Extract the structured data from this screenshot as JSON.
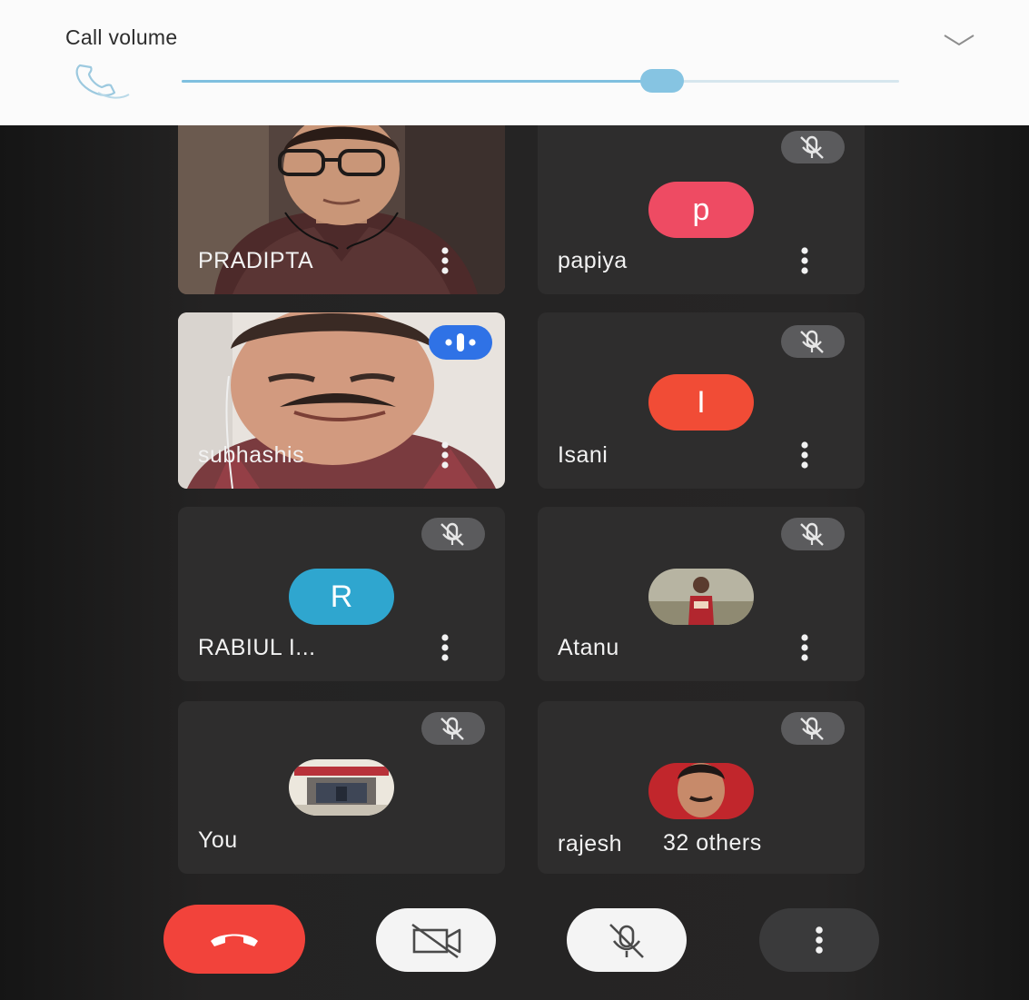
{
  "volume": {
    "title": "Call volume",
    "level": 0.67,
    "icon": "phone-icon",
    "collapse_icon": "chevron-down-icon"
  },
  "participants": [
    {
      "name": "PRADIPTA",
      "type": "video",
      "muted": false
    },
    {
      "name": "papiya",
      "type": "avatar",
      "initial": "p",
      "avatar_color": "#ee4b63",
      "muted": true
    },
    {
      "name": "subhashis",
      "type": "video",
      "muted": false,
      "speaking": true
    },
    {
      "name": "Isani",
      "type": "avatar",
      "initial": "I",
      "avatar_color": "#f14c36",
      "muted": true
    },
    {
      "name": "RABIUL I...",
      "type": "avatar",
      "initial": "R",
      "avatar_color": "#2fa6cf",
      "muted": true
    },
    {
      "name": "Atanu",
      "type": "photo",
      "muted": true
    },
    {
      "name": "You",
      "type": "photo",
      "muted": true
    },
    {
      "name": "rajesh",
      "type": "photo",
      "muted": true
    }
  ],
  "others_label": "32 others",
  "controls": [
    {
      "name": "end-call",
      "icon": "phone-hangup-icon",
      "color": "#f2433b"
    },
    {
      "name": "camera-off",
      "icon": "video-off-icon",
      "color": "#f4f4f4"
    },
    {
      "name": "mic-off",
      "icon": "mic-off-icon",
      "color": "#f4f4f4"
    },
    {
      "name": "more",
      "icon": "more-vertical-icon",
      "color": "#3a3a3b"
    }
  ],
  "colors": {
    "accent": "#7fc0df",
    "tile_bg": "#2e2d2d",
    "mute_badge": "#5b5b5d",
    "speaking_badge": "#2f72e6"
  }
}
